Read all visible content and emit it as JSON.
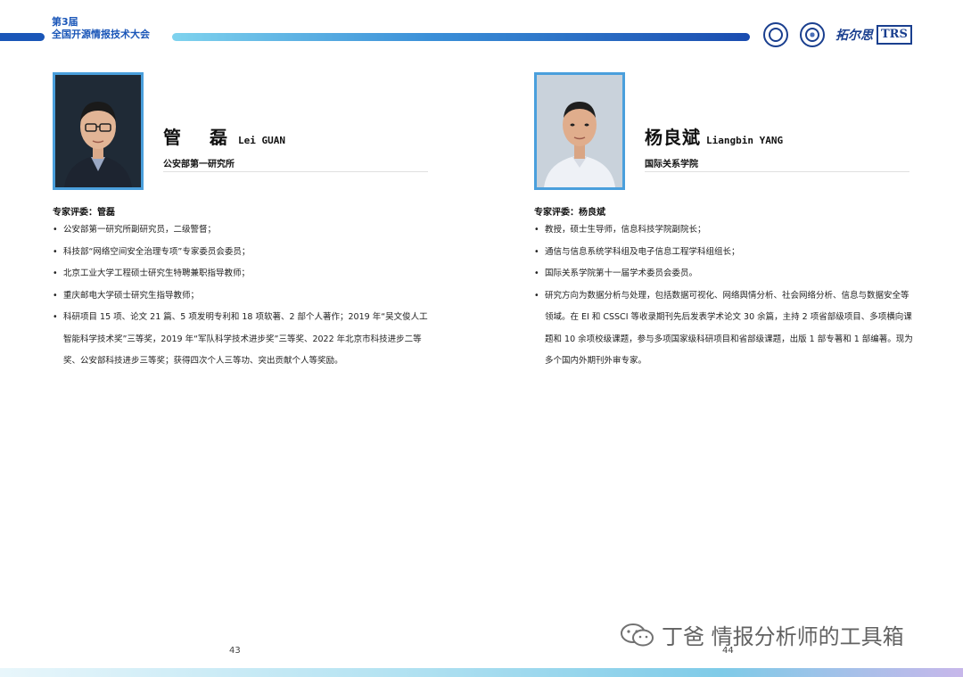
{
  "header": {
    "conference_line1": "第3届",
    "conference_line2": "全国开源情报技术大会",
    "logos": [
      "university-seal-icon",
      "institute-seal-icon",
      "trs-logo-icon"
    ],
    "trs_cn": "拓尔思",
    "trs_en": "TRS"
  },
  "left_profile": {
    "name_cn": "管　磊",
    "name_en": "Lei GUAN",
    "affiliation": "公安部第一研究所",
    "section_heading": "专家评委：管磊",
    "bullets": [
      "公安部第一研究所副研究员，二级警督；",
      "科技部“网络空间安全治理专项”专家委员会委员；",
      "北京工业大学工程硕士研究生特聘兼职指导教师；",
      "重庆邮电大学硕士研究生指导教师；",
      "科研项目 15 项、论文 21 篇、5 项发明专利和 18 项软著、2 部个人著作；2019 年“吴文俊人工智能科学技术奖”三等奖，2019 年“军队科学技术进步奖”三等奖、2022 年北京市科技进步二等奖、公安部科技进步三等奖；获得四次个人三等功、突出贡献个人等奖励。"
    ],
    "page_number": "43"
  },
  "right_profile": {
    "name_cn": "杨良斌",
    "name_en": "Liangbin YANG",
    "affiliation": "国际关系学院",
    "section_heading": "专家评委：杨良斌",
    "bullets": [
      "教授，硕士生导师，信息科技学院副院长；",
      "通信与信息系统学科组及电子信息工程学科组组长；",
      "国际关系学院第十一届学术委员会委员。",
      "研究方向为数据分析与处理，包括数据可视化、网络舆情分析、社会网络分析、信息与数据安全等领域。在 EI 和 CSSCI 等收录期刊先后发表学术论文 30 余篇，主持 2 项省部级项目、多项横向课题和 10 余项校级课题，参与多项国家级科研项目和省部级课题，出版 1 部专著和 1 部编著。现为多个国内外期刊外审专家。"
    ],
    "page_number": "44"
  },
  "watermark": {
    "text": "丁爸 情报分析师的工具箱",
    "icon": "wechat-icon"
  },
  "colors": {
    "brand_blue": "#1a56b8",
    "photo_border": "#4a9fdc"
  }
}
